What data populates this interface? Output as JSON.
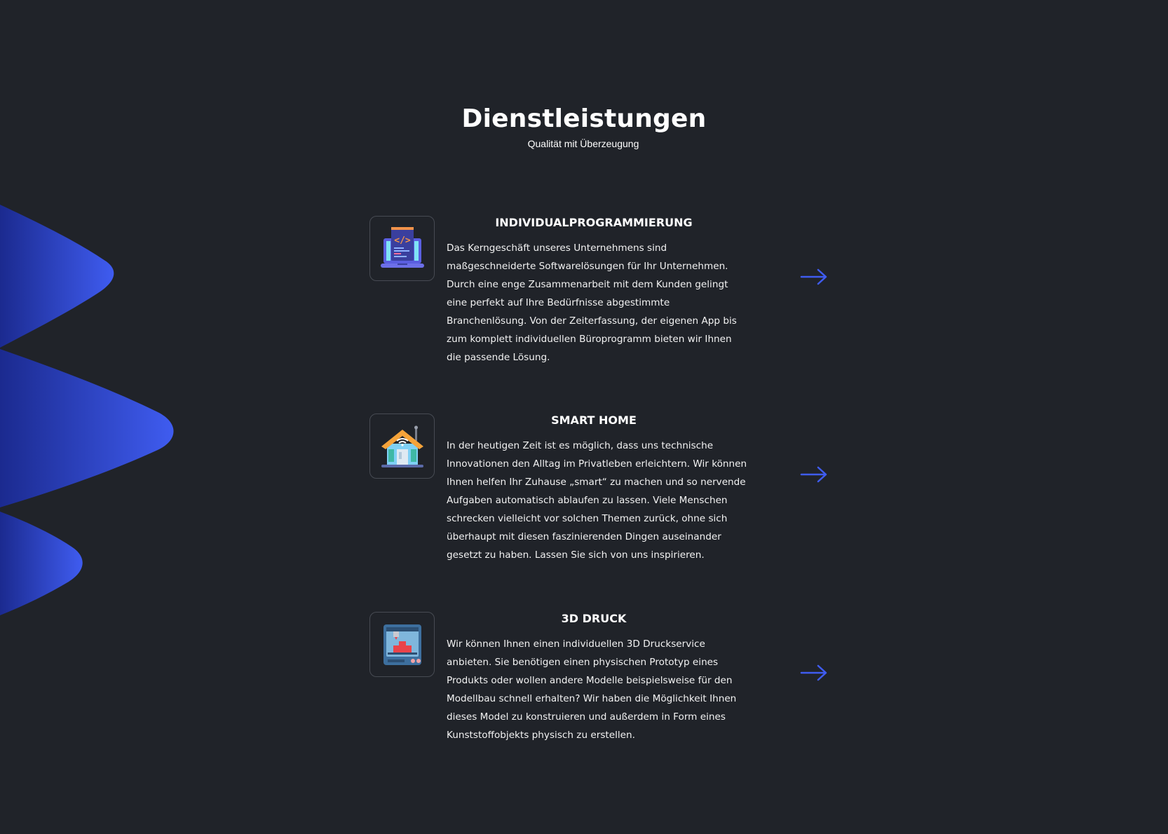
{
  "heading": {
    "title": "Dienstleistungen",
    "subtitle": "Qualität mit Überzeugung"
  },
  "colors": {
    "background": "#202329",
    "accent": "#3f5cf0",
    "accent_dark": "#1b2a8f",
    "icon_border": "#474b53"
  },
  "services": [
    {
      "title": "INDIVIDUALPROGRAMMIERUNG",
      "icon": "laptop-code-icon",
      "text": "Das Kerngeschäft unseres Unternehmens sind maßgeschneiderte Softwarelösungen für Ihr Unternehmen. Durch eine enge Zusammenarbeit mit dem Kunden gelingt eine perfekt auf Ihre Bedürfnisse abgestimmte Branchenlösung. Von der Zeiterfassung, der eigenen App bis zum komplett individuellen Büroprogramm bieten wir Ihnen die passende Lösung.",
      "link_icon": "arrow-right-icon"
    },
    {
      "title": "SMART HOME",
      "icon": "smart-house-icon",
      "text": "In der heutigen Zeit ist es möglich, dass uns technische Innovationen den Alltag im Privatleben erleichtern. Wir können Ihnen helfen Ihr Zuhause „smart“ zu machen und so nervende Aufgaben automatisch ablaufen zu lassen. Viele Menschen schrecken vielleicht vor solchen Themen zurück, ohne sich überhaupt mit diesen faszinierenden Dingen auseinander gesetzt zu haben. Lassen Sie sich von uns inspirieren.",
      "link_icon": "arrow-right-icon"
    },
    {
      "title": "3D DRUCK",
      "icon": "3d-printer-icon",
      "text": "Wir können Ihnen einen individuellen 3D Druckservice anbieten. Sie benötigen einen physischen Prototyp eines Produkts oder wollen andere Modelle beispielsweise für den Modellbau schnell erhalten? Wir haben die Möglichkeit Ihnen dieses Model zu konstruieren und außerdem in Form eines Kunststoffobjekts physisch zu erstellen.",
      "link_icon": "arrow-right-icon"
    }
  ]
}
